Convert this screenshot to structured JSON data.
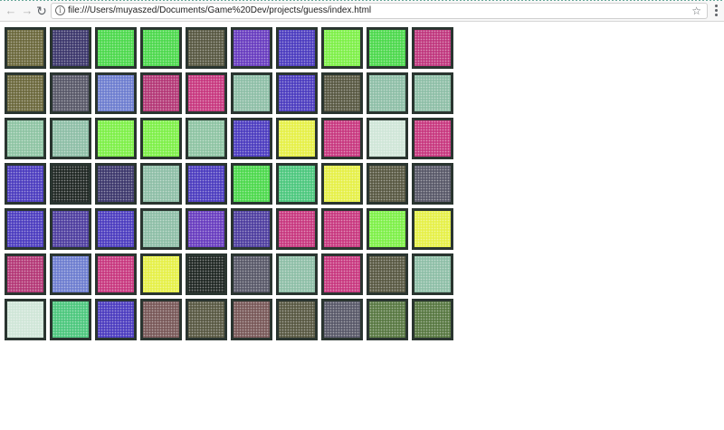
{
  "browser": {
    "url": "file:///Users/muyaszed/Documents/Game%20Dev/projects/guess/index.html",
    "back_icon": "arrow-left-icon",
    "forward_icon": "arrow-right-icon",
    "reload_icon": "reload-icon",
    "info_icon": "info-icon",
    "bookmark_icon": "star-icon",
    "menu_icon": "kebab-menu-icon"
  },
  "board": {
    "rows": 7,
    "columns": 10,
    "tiles": [
      [
        "#6d6a3e",
        "#3f3a6e",
        "#4fd94f",
        "#4fd94f",
        "#5a5a44",
        "#6a3fc0",
        "#4e3fc0",
        "#7ff04a",
        "#4fd94f",
        "#c0397f"
      ],
      [
        "#6d6a3e",
        "#5a5a6a",
        "#6f7fd0",
        "#b43a78",
        "#c83a80",
        "#8fbfa8",
        "#4e3fc0",
        "#5a5a44",
        "#8fbfa8",
        "#8fbfa8"
      ],
      [
        "#8fc4a4",
        "#8fbfa8",
        "#7ff04a",
        "#7ff04a",
        "#8fc4a4",
        "#4e3fc0",
        "#e6f04a",
        "#c83a80",
        "#d0e6d8",
        "#c83a80"
      ],
      [
        "#4e3fc0",
        "#222a26",
        "#3f3a6e",
        "#8fbfa8",
        "#4e3fc0",
        "#4fd94f",
        "#4fc87f",
        "#e6f04a",
        "#5a5a44",
        "#5a5a6a"
      ],
      [
        "#4e3fc0",
        "#5040a0",
        "#4e3fc0",
        "#8fbfa8",
        "#6a3fc0",
        "#5040a0",
        "#c83a80",
        "#c83a80",
        "#7ff04a",
        "#e6f04a"
      ],
      [
        "#b43a78",
        "#6f7fd0",
        "#c83a80",
        "#e6f04a",
        "#222a26",
        "#5a5a6a",
        "#8fbfa8",
        "#c83a80",
        "#5a5a44",
        "#8fbfa8"
      ],
      [
        "#d0e6d8",
        "#4fc87f",
        "#4e3fc0",
        "#7a5a5a",
        "#5a5a44",
        "#7a5a5a",
        "#5a5a44",
        "#5a5a6a",
        "#5a7a44",
        "#5a7a44"
      ]
    ]
  }
}
